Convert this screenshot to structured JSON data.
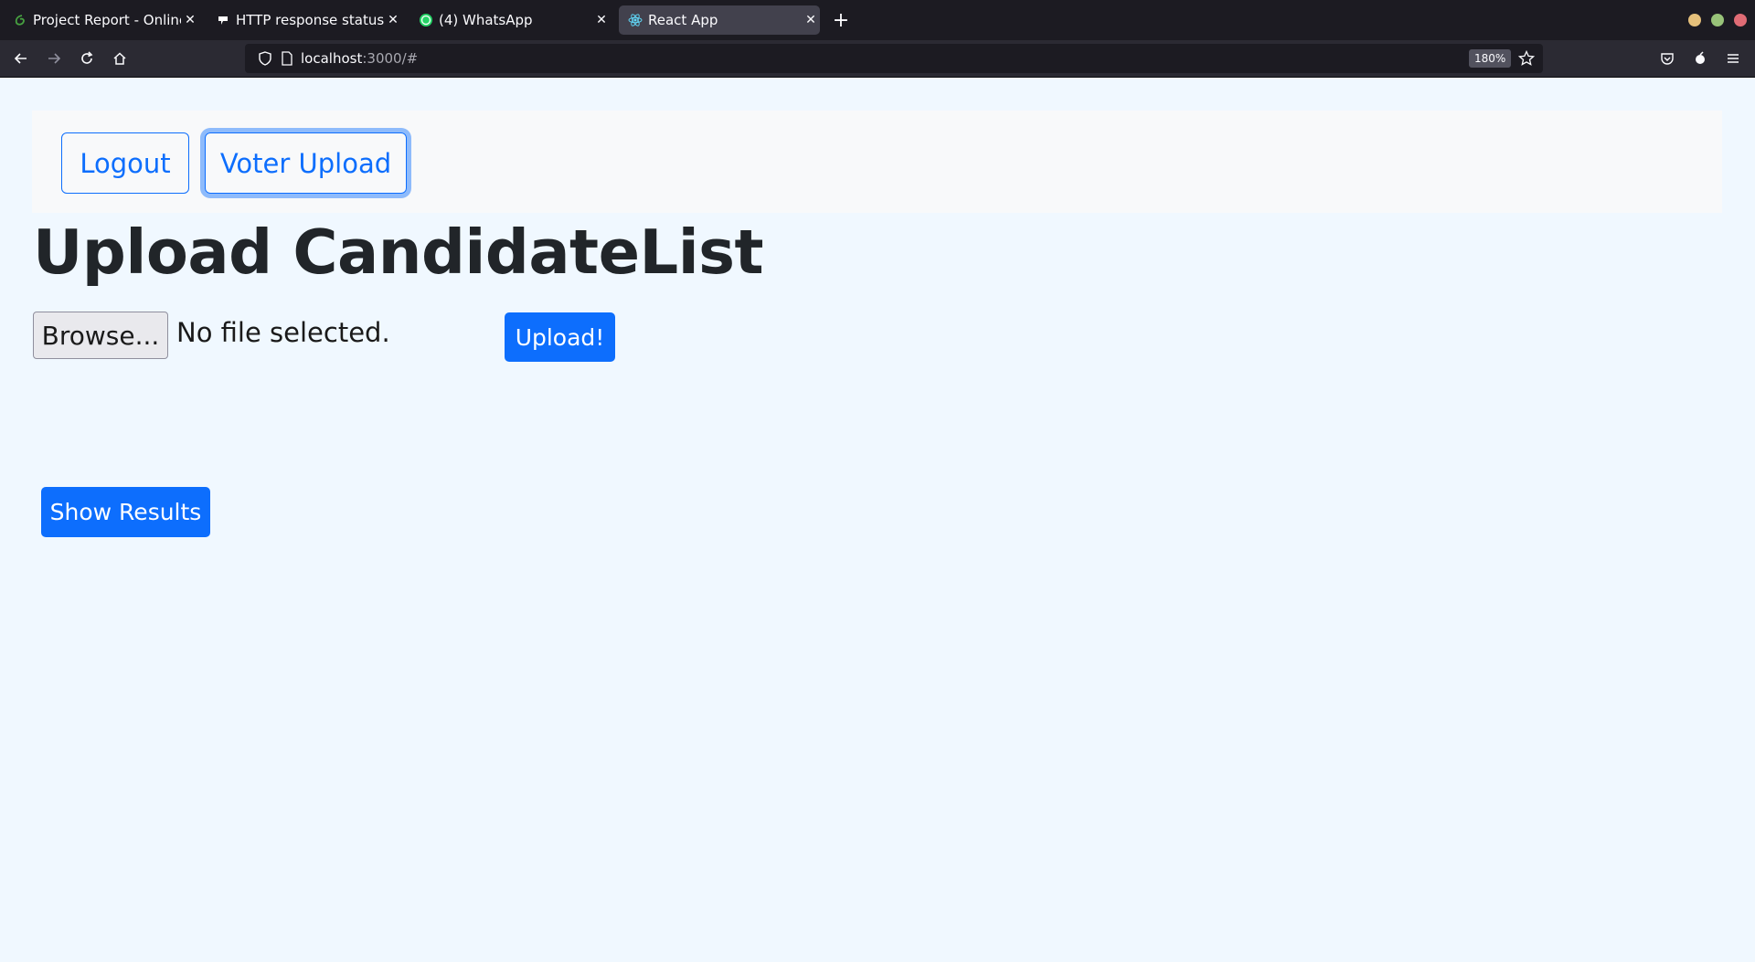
{
  "browser": {
    "tabs": [
      {
        "title": "Project Report - Online L",
        "icon": "overleaf-icon",
        "active": false
      },
      {
        "title": "HTTP response status co",
        "icon": "mdn-icon",
        "active": false
      },
      {
        "title": "(4) WhatsApp",
        "icon": "whatsapp-icon",
        "active": false
      },
      {
        "title": "React App",
        "icon": "react-icon",
        "active": true
      }
    ],
    "url_host": "localhost",
    "url_rest": ":3000/#",
    "zoom": "180%"
  },
  "nav": {
    "logout_label": "Logout",
    "voter_upload_label": "Voter Upload"
  },
  "main": {
    "heading": "Upload CandidateList",
    "browse_label": "Browse...",
    "file_status": "No file selected.",
    "upload_label": "Upload!",
    "show_results_label": "Show Results"
  },
  "colors": {
    "primary": "#0d6efd",
    "page_background": "#f0f8ff",
    "nav_panel": "#f8f9fa",
    "heading_text": "#212529"
  }
}
